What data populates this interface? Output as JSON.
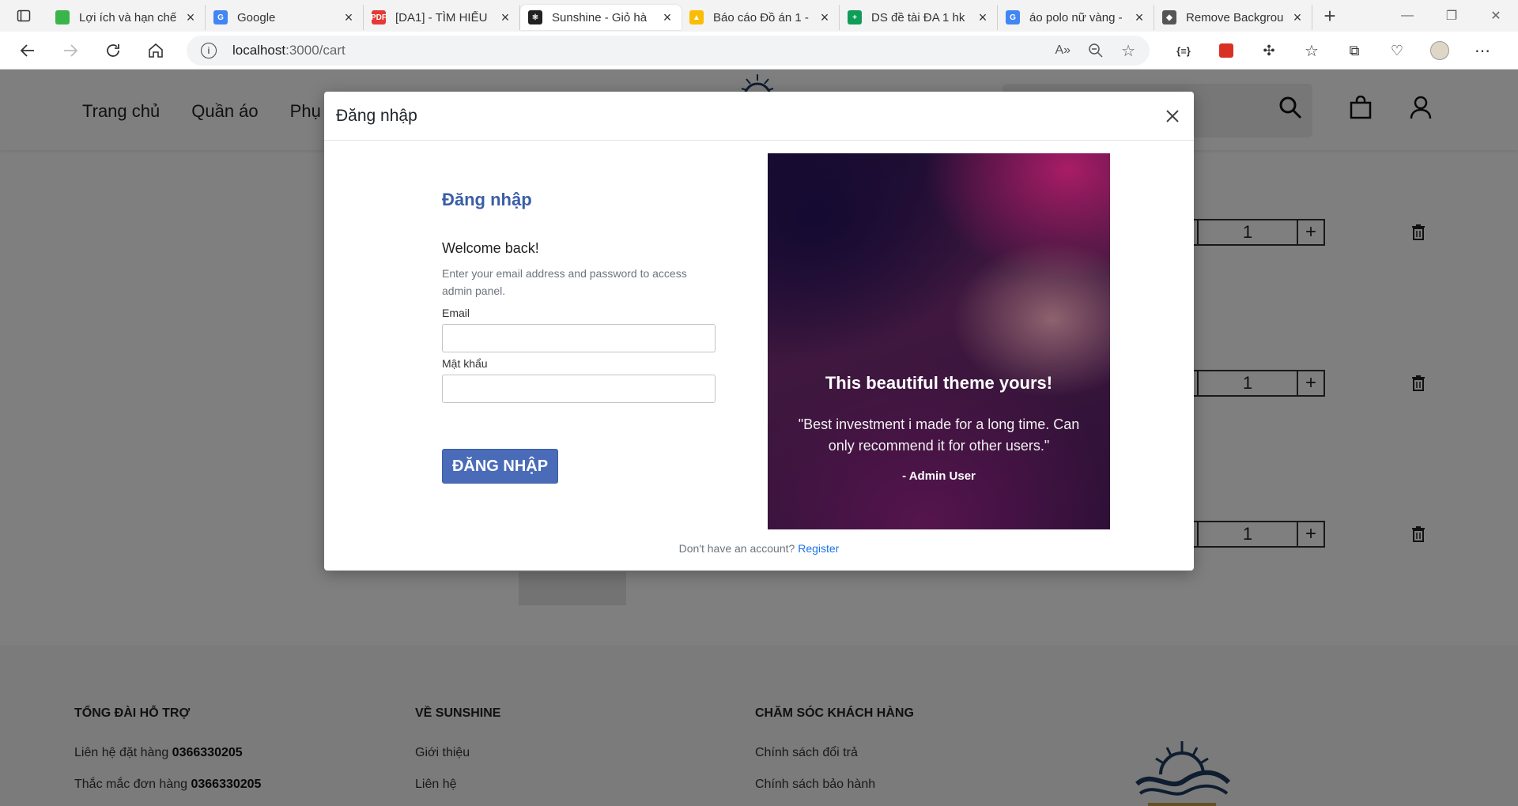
{
  "browser": {
    "tabs": [
      {
        "title": "Lợi ích và hạn chế",
        "color": "#3bb54a",
        "glyph": ""
      },
      {
        "title": "Google",
        "color": "#4285f4",
        "glyph": "G"
      },
      {
        "title": "[DA1] - TÌM HIỂU",
        "color": "#e53935",
        "glyph": "PDF"
      },
      {
        "title": "Sunshine - Giỏ hà",
        "color": "#222222",
        "glyph": "⚛"
      },
      {
        "title": "Báo cáo Đồ án 1 -",
        "color": "#fbbc04",
        "glyph": "▲"
      },
      {
        "title": "DS đề tài ĐA 1 hk",
        "color": "#0f9d58",
        "glyph": "+"
      },
      {
        "title": "áo polo nữ vàng -",
        "color": "#4285f4",
        "glyph": "G"
      },
      {
        "title": "Remove Backgrou",
        "color": "#555555",
        "glyph": "◆"
      }
    ],
    "url_host": "localhost",
    "url_path": ":3000/cart"
  },
  "site": {
    "nav": [
      "Trang chủ",
      "Quần áo",
      "Phụ"
    ],
    "cart_items": [
      {
        "qty": "1"
      },
      {
        "qty": "1"
      },
      {
        "qty": "1"
      }
    ]
  },
  "footer": {
    "col1": {
      "heading": "TỔNG ĐÀI HỖ TRỢ",
      "line1_label": "Liên hệ đặt hàng ",
      "line1_value": "0366330205",
      "line2_label": "Thắc mắc đơn hàng ",
      "line2_value": "0366330205"
    },
    "col2": {
      "heading": "VỀ SUNSHINE",
      "items": [
        "Giới thiệu",
        "Liên hệ"
      ]
    },
    "col3": {
      "heading": "CHĂM SÓC KHÁCH HÀNG",
      "items": [
        "Chính sách đổi trả",
        "Chính sách bảo hành"
      ]
    }
  },
  "modal": {
    "title": "Đăng nhập",
    "form_heading": "Đăng nhập",
    "welcome": "Welcome back!",
    "description": "Enter your email address and password to access admin panel.",
    "email_label": "Email",
    "email_value": "",
    "password_label": "Mật khẩu",
    "password_value": "",
    "submit_label": "ĐĂNG NHẬP",
    "promo_title": "This beautiful theme yours!",
    "promo_quote": "\"Best investment i made for a long time. Can only recommend it for other users.\"",
    "promo_author": "- Admin User",
    "footer_text": "Don't have an account? ",
    "register_link": "Register"
  }
}
